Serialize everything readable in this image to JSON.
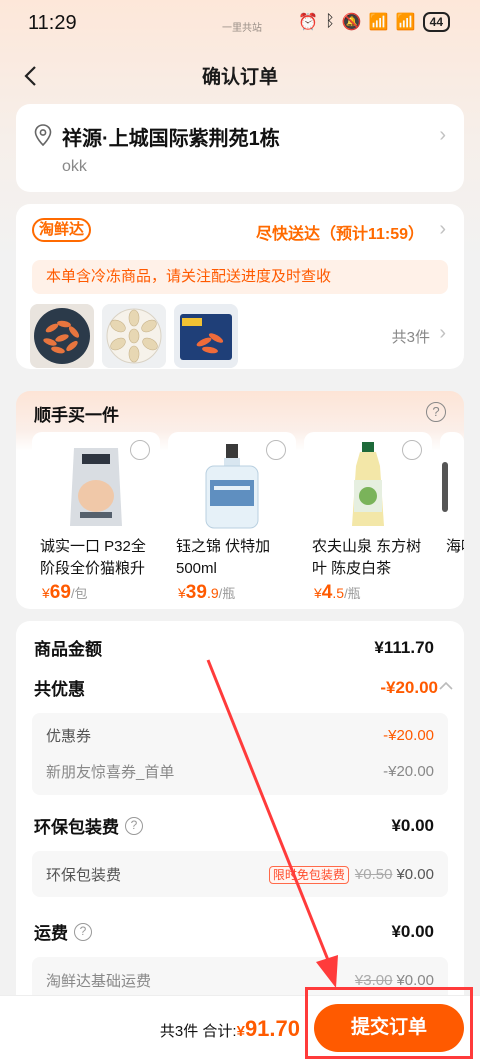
{
  "status_bar": {
    "time": "11:29",
    "center_text": "一里共站",
    "battery": "44"
  },
  "header": {
    "title": "确认订单"
  },
  "address": {
    "title": "祥源·上城国际紫荆苑1栋",
    "name": "okk"
  },
  "delivery": {
    "brand": "淘鲜达",
    "time_text": "尽快送达（预计11:59）",
    "notice": "本单含冷冻商品，请关注配送进度及时查收",
    "count": "共3件"
  },
  "addon": {
    "title": "顺手买一件",
    "items": [
      {
        "name": "诚实一口 P32全阶段全价猫粮升",
        "currency": "¥",
        "price_int": "69",
        "price_dec": "",
        "unit": "/包"
      },
      {
        "name": "钰之锦 伏特加 500ml",
        "currency": "¥",
        "price_int": "39",
        "price_dec": ".9",
        "unit": "/瓶"
      },
      {
        "name": "农夫山泉 东方树叶 陈皮白茶",
        "currency": "¥",
        "price_int": "4",
        "price_dec": ".5",
        "unit": "/瓶"
      },
      {
        "name": "海味"
      }
    ]
  },
  "fees": {
    "goods_label": "商品金额",
    "goods_value": "¥111.70",
    "discount_label": "共优惠",
    "discount_value": "-¥20.00",
    "coupon_label": "优惠券",
    "coupon_value": "-¥20.00",
    "new_user_label": "新朋友惊喜券_首单",
    "new_user_value": "-¥20.00",
    "pack_label": "环保包装费",
    "pack_value": "¥0.00",
    "pack_sub_label": "环保包装费",
    "pack_badge": "限时免包装费",
    "pack_orig": "¥0.50",
    "pack_sub_value": "¥0.00",
    "ship_label": "运费",
    "ship_value": "¥0.00",
    "ship_sub_label": "淘鲜达基础运费",
    "ship_orig": "¥3.00",
    "ship_sub_value": "¥0.00"
  },
  "footer": {
    "summary": "共3件 合计:",
    "currency": "¥",
    "total": "91.70",
    "submit": "提交订单"
  },
  "colors": {
    "accent": "#ff5a00",
    "annotation": "#ff3b3b"
  }
}
